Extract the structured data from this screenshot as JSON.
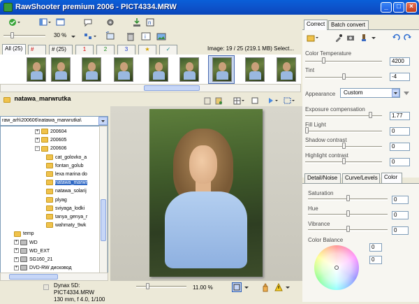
{
  "window": {
    "title": "RawShooter premium 2006 - PICT4334.MRW",
    "min": "_",
    "max": "□",
    "close": "×"
  },
  "toolbar": {
    "zoom": "30 %"
  },
  "filter_tabs": [
    "All (25)",
    "#",
    "# (25)",
    "1",
    "2",
    "3",
    "★",
    "✓"
  ],
  "image_info": "Image: 19 / 25 (219.1 MB) Select...",
  "folder": {
    "name": "natawa_marwrutka",
    "path": "raw_arh\\200606\\natawa_marwrutka\\"
  },
  "tree": [
    {
      "label": "200604",
      "indent": 1,
      "plus": true
    },
    {
      "label": "200605",
      "indent": 1,
      "plus": true
    },
    {
      "label": "200606",
      "indent": 1,
      "plus": true
    },
    {
      "label": "cat_golovko_a",
      "indent": 2
    },
    {
      "label": "fontan_golub",
      "indent": 2
    },
    {
      "label": "lexa marina do",
      "indent": 2
    },
    {
      "label": "natawa_marwr",
      "indent": 2,
      "selected": true
    },
    {
      "label": "natawa_solarij",
      "indent": 2
    },
    {
      "label": "plyag",
      "indent": 2
    },
    {
      "label": "sviyaga_lodki",
      "indent": 2
    },
    {
      "label": "tanya_genya_r",
      "indent": 2
    },
    {
      "label": "wahmaty_9wk",
      "indent": 2
    },
    {
      "label": "temp",
      "indent": 0
    },
    {
      "label": "WD",
      "indent": 0,
      "plus": true,
      "drive": true
    },
    {
      "label": "WD_EXT",
      "indent": 0,
      "plus": true,
      "drive": true
    },
    {
      "label": "SG160_21",
      "indent": 0,
      "plus": true,
      "drive": true
    },
    {
      "label": "DVD-RW дисковод",
      "indent": 0,
      "plus": true,
      "drive": true
    }
  ],
  "status": {
    "camera": "Dynax 5D:",
    "file": "PICT4334.MRW",
    "exposure": "130 mm, f 4.0, 1/100",
    "zoom": "11.00 %"
  },
  "right_tabs": {
    "correct": "Correct",
    "batch": "Batch convert"
  },
  "correct": {
    "color_temp_label": "Color Temperature",
    "color_temp": "4200",
    "tint_label": "Tint",
    "tint": "-4",
    "appearance_label": "Appearance",
    "appearance": "Custom",
    "exposure_label": "Exposure compensation",
    "exposure": "1.77",
    "fill_label": "Fill Light",
    "fill": "0",
    "shadow_label": "Shadow contrast",
    "shadow": "0",
    "highlight_label": "Highlight contrast",
    "highlight": "0"
  },
  "sub_tabs": {
    "detail": "Detail/Noise",
    "curve": "Curve/Levels",
    "color": "Color"
  },
  "color": {
    "saturation_label": "Saturation",
    "saturation": "0",
    "hue_label": "Hue",
    "hue": "0",
    "vibrance_label": "Vibrance",
    "vibrance": "0",
    "balance_label": "Color Balance",
    "balance_a": "0",
    "balance_b": "0"
  }
}
